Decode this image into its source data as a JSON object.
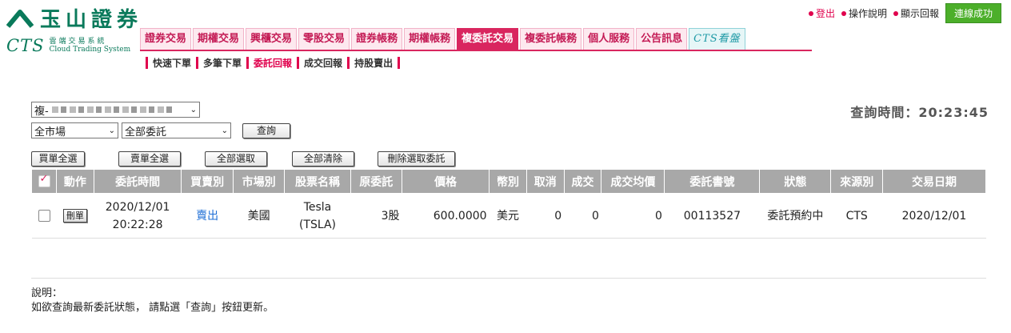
{
  "brand": {
    "name": "玉山證券",
    "sub": "CTS",
    "sys_zh": "雲端交易系統",
    "sys_en": "Cloud Trading System"
  },
  "toplinks": {
    "logout": "登出",
    "help": "操作說明",
    "show_reply": "顯示回報",
    "status": "連線成功"
  },
  "nav": [
    "證券交易",
    "期權交易",
    "興櫃交易",
    "零股交易",
    "證券帳務",
    "期權帳務",
    "複委託交易",
    "複委託帳務",
    "個人服務",
    "公告訊息",
    "CTS看盤"
  ],
  "nav_active": "複委託交易",
  "subnav": [
    "快速下單",
    "多筆下單",
    "委託回報",
    "成交回報",
    "持股賣出"
  ],
  "subnav_active": "委託回報",
  "account": {
    "prefix": "複-"
  },
  "filters": {
    "market": "全市場",
    "orders": "全部委託",
    "query": "查詢"
  },
  "query_time": "查詢時間：20:23:45",
  "actions": {
    "buy_all": "買單全選",
    "sell_all": "賣單全選",
    "select_all": "全部選取",
    "clear_all": "全部清除",
    "delete_selected": "刪除選取委託"
  },
  "table": {
    "headers": [
      "動作",
      "委託時間",
      "買賣別",
      "市場別",
      "股票名稱",
      "原委託",
      "價格",
      "幣別",
      "取消",
      "成交",
      "成交均價",
      "委託書號",
      "狀態",
      "來源別",
      "交易日期"
    ],
    "rows": [
      {
        "action": "刪單",
        "time_date": "2020/12/01",
        "time_clock": "20:22:28",
        "side": "賣出",
        "market": "美國",
        "name": "Tesla",
        "ticker": "(TSLA)",
        "qty": "3股",
        "price": "600.0000",
        "currency": "美元",
        "cancel": "0",
        "filled": "0",
        "avg": "0",
        "order_no": "00113527",
        "status": "委託預約中",
        "source": "CTS",
        "trade_date": "2020/12/01"
      }
    ]
  },
  "note": {
    "title": "說明：",
    "text": "如欲查詢最新委託狀態， 請點選「查詢」按鈕更新。"
  },
  "colors": {
    "brand_green": "#0a7a5b",
    "accent": "#d9265f",
    "status_green": "#4caf2a",
    "side_blue": "#1f6fd6"
  }
}
